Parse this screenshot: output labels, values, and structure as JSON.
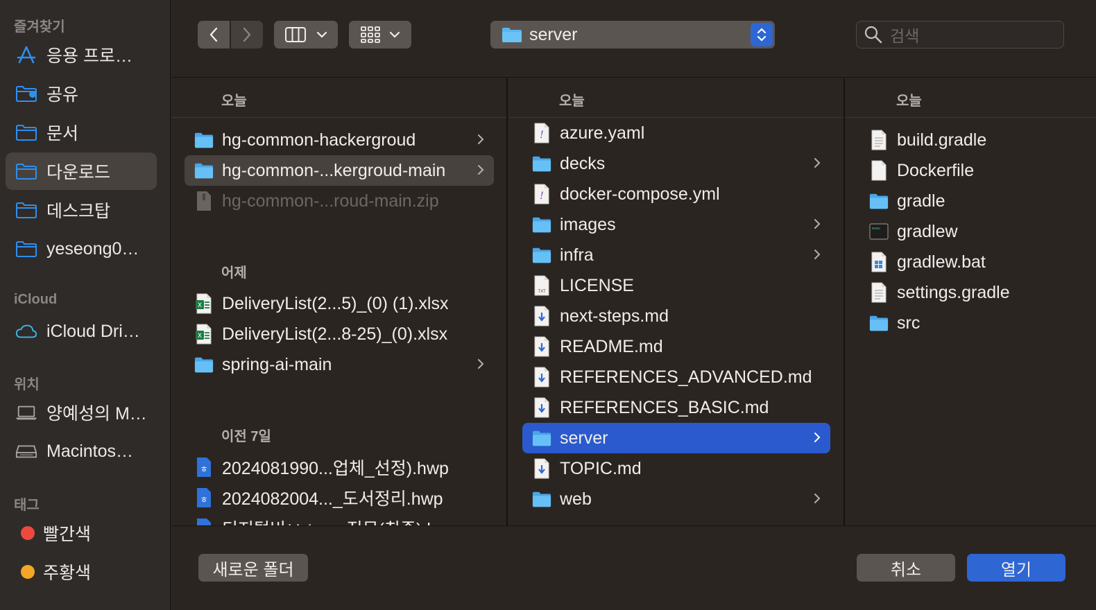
{
  "sidebar": {
    "favorites_title": "즐겨찾기",
    "favorites": [
      {
        "label": "응용 프로…",
        "icon": "applications-icon"
      },
      {
        "label": "공유",
        "icon": "shared-folder-icon"
      },
      {
        "label": "문서",
        "icon": "folder-icon"
      },
      {
        "label": "다운로드",
        "icon": "folder-icon",
        "selected": true
      },
      {
        "label": "데스크탑",
        "icon": "folder-icon"
      },
      {
        "label": "yeseong0…",
        "icon": "folder-icon"
      }
    ],
    "icloud_title": "iCloud",
    "icloud": [
      {
        "label": "iCloud Dri…",
        "icon": "cloud-icon"
      }
    ],
    "locations_title": "위치",
    "locations": [
      {
        "label": "양예성의 M…",
        "icon": "laptop-icon"
      },
      {
        "label": "Macintos…",
        "icon": "drive-icon"
      }
    ],
    "tags_title": "태그",
    "tags": [
      {
        "label": "빨간색",
        "color": "#f0483e"
      },
      {
        "label": "주황색",
        "color": "#f5a623"
      }
    ]
  },
  "toolbar": {
    "path_label": "server",
    "search_placeholder": "검색"
  },
  "columns": {
    "col1": {
      "groups": [
        {
          "label": "오늘",
          "items": [
            {
              "label": "hg-common-hackergroud",
              "type": "folder",
              "chevron": true
            },
            {
              "label": "hg-common-...kergroud-main",
              "type": "folder",
              "chevron": true,
              "selected": "gray"
            },
            {
              "label": "hg-common-...roud-main.zip",
              "type": "zip",
              "dim": true
            }
          ]
        },
        {
          "label": "어제",
          "items": [
            {
              "label": "DeliveryList(2...5)_(0) (1).xlsx",
              "type": "xlsx"
            },
            {
              "label": "DeliveryList(2...8-25)_(0).xlsx",
              "type": "xlsx"
            },
            {
              "label": "spring-ai-main",
              "type": "folder",
              "chevron": true
            }
          ]
        },
        {
          "label": "이전 7일",
          "items": [
            {
              "label": "2024081990...업체_선정).hwp",
              "type": "hwp"
            },
            {
              "label": "2024082004..._도서정리.hwp",
              "type": "hwp"
            },
            {
              "label": "디지털비ㅂㅅ......직무(최종).hwp",
              "type": "hwp"
            }
          ]
        }
      ]
    },
    "col2": {
      "header": "오늘",
      "items": [
        {
          "label": "azure.yaml",
          "type": "yaml"
        },
        {
          "label": "decks",
          "type": "folder",
          "chevron": true
        },
        {
          "label": "docker-compose.yml",
          "type": "yaml"
        },
        {
          "label": "images",
          "type": "folder",
          "chevron": true
        },
        {
          "label": "infra",
          "type": "folder",
          "chevron": true
        },
        {
          "label": "LICENSE",
          "type": "txt"
        },
        {
          "label": "next-steps.md",
          "type": "md"
        },
        {
          "label": "README.md",
          "type": "md"
        },
        {
          "label": "REFERENCES_ADVANCED.md",
          "type": "md"
        },
        {
          "label": "REFERENCES_BASIC.md",
          "type": "md"
        },
        {
          "label": "server",
          "type": "folder",
          "chevron": true,
          "selected": "blue"
        },
        {
          "label": "TOPIC.md",
          "type": "md"
        },
        {
          "label": "web",
          "type": "folder",
          "chevron": true
        }
      ]
    },
    "col3": {
      "header": "오늘",
      "items": [
        {
          "label": "build.gradle",
          "type": "doc"
        },
        {
          "label": "Dockerfile",
          "type": "blank"
        },
        {
          "label": "gradle",
          "type": "folder"
        },
        {
          "label": "gradlew",
          "type": "exec"
        },
        {
          "label": "gradlew.bat",
          "type": "bat"
        },
        {
          "label": "settings.gradle",
          "type": "doc"
        },
        {
          "label": "src",
          "type": "folder"
        }
      ]
    }
  },
  "bottom": {
    "new_folder_label": "새로운 폴더",
    "cancel_label": "취소",
    "open_label": "열기"
  },
  "colors": {
    "accent": "#2e66d4",
    "folder": "#5ab4f0"
  }
}
